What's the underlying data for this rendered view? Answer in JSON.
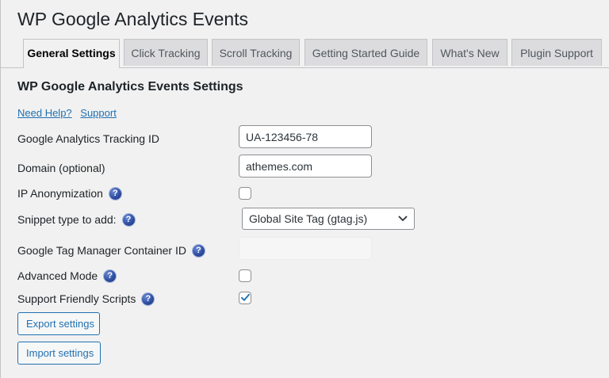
{
  "page": {
    "title": "WP Google Analytics Events"
  },
  "tabs": [
    {
      "label": "General Settings",
      "active": true
    },
    {
      "label": "Click Tracking",
      "active": false
    },
    {
      "label": "Scroll Tracking",
      "active": false
    },
    {
      "label": "Getting Started Guide",
      "active": false
    },
    {
      "label": "What's New",
      "active": false
    },
    {
      "label": "Plugin Support",
      "active": false
    }
  ],
  "settings": {
    "title": "WP Google Analytics Events Settings",
    "help_links": {
      "need_help": "Need Help?",
      "support": "Support"
    },
    "tracking_id": {
      "label": "Google Analytics Tracking ID",
      "value": "UA-123456-78"
    },
    "domain": {
      "label": "Domain (optional)",
      "value": "athemes.com"
    },
    "ip_anonymization": {
      "label": "IP Anonymization",
      "checked": false
    },
    "snippet_type": {
      "label": "Snippet type to add:",
      "selected": "Global Site Tag (gtag.js)"
    },
    "gtm_container": {
      "label": "Google Tag Manager Container ID",
      "value": "",
      "disabled": true
    },
    "advanced_mode": {
      "label": "Advanced Mode",
      "checked": false
    },
    "support_scripts": {
      "label": "Support Friendly Scripts",
      "checked": true
    },
    "help_icon_glyph": "?"
  },
  "buttons": {
    "export": "Export settings",
    "import": "Import settings"
  },
  "colors": {
    "link": "#2271b1",
    "background": "#f1f1f1",
    "help_icon": "#2f4fa2"
  }
}
